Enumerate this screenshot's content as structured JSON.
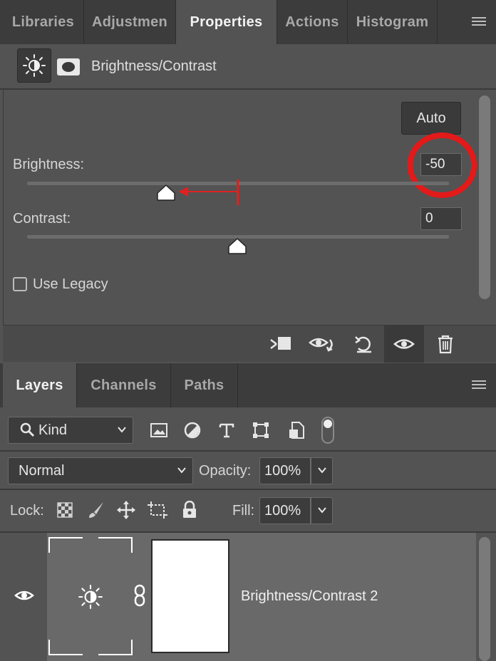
{
  "top_panel": {
    "tabs": [
      {
        "label": "Libraries",
        "active": false
      },
      {
        "label": "Adjustmen",
        "active": false
      },
      {
        "label": "Properties",
        "active": true
      },
      {
        "label": "Actions",
        "active": false
      },
      {
        "label": "Histogram",
        "active": false
      }
    ],
    "menu_icon": "hamburger-menu-icon"
  },
  "properties": {
    "title": "Brightness/Contrast",
    "adjustment_icon": "brightness-contrast-icon",
    "mask_icon": "layer-mask-icon",
    "auto_label": "Auto",
    "brightness": {
      "label": "Brightness:",
      "value": "-50",
      "slider_fraction": 0.333
    },
    "contrast": {
      "label": "Contrast:",
      "value": "0",
      "slider_fraction": 0.5
    },
    "legacy": {
      "label": "Use Legacy",
      "checked": false
    },
    "annotation_color": "#e21a1a",
    "footer_icons": [
      "clip-to-layer-icon",
      "view-previous-state-icon",
      "reset-icon",
      "visibility-eye-icon",
      "trash-icon"
    ]
  },
  "layers_panel": {
    "tabs": [
      {
        "label": "Layers",
        "active": true
      },
      {
        "label": "Channels",
        "active": false
      },
      {
        "label": "Paths",
        "active": false
      }
    ],
    "filter": {
      "label": "Kind",
      "icons": [
        "image-filter-icon",
        "adjustment-filter-icon",
        "type-filter-icon",
        "shape-filter-icon",
        "smart-object-filter-icon"
      ]
    },
    "blend_mode": "Normal",
    "opacity": {
      "label": "Opacity:",
      "value": "100%"
    },
    "lock": {
      "label": "Lock:",
      "icons": [
        "lock-transparent-icon",
        "lock-pixels-icon",
        "lock-position-icon",
        "lock-artboard-icon",
        "lock-all-icon"
      ]
    },
    "fill": {
      "label": "Fill:",
      "value": "100%"
    },
    "layers": [
      {
        "name": "Brightness/Contrast 2",
        "visible": true
      }
    ]
  }
}
